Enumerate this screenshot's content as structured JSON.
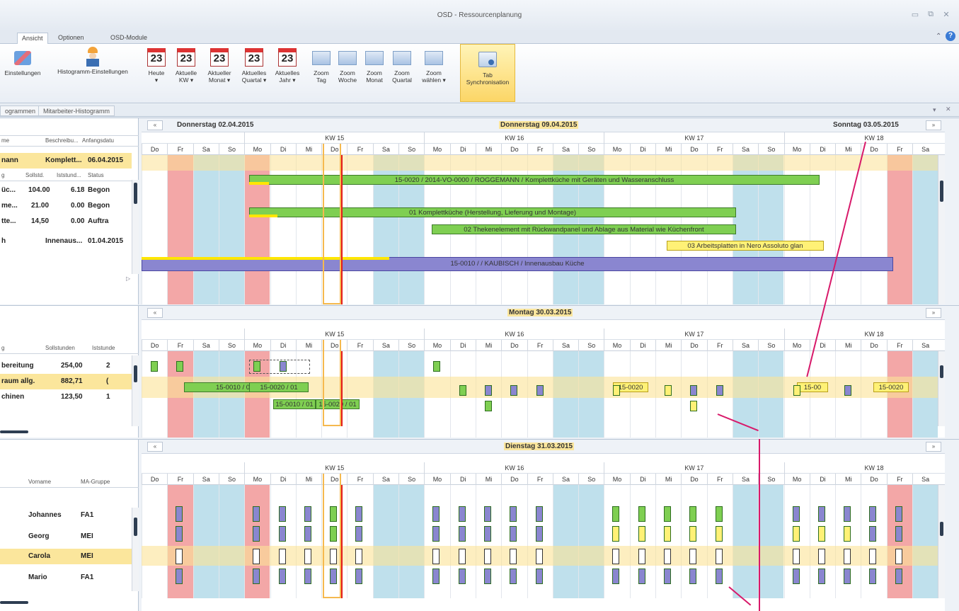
{
  "window": {
    "title": "OSD - Ressourcenplanung"
  },
  "menu_tabs": [
    "Ansicht",
    "Optionen",
    "OSD-Module"
  ],
  "ribbon": {
    "buttons": [
      {
        "label": "Einstellungen",
        "icon": "settings-icon"
      },
      {
        "label": "Histogramm-Einstellungen",
        "icon": "worker-icon"
      },
      {
        "label": "Heute",
        "sub": "▾",
        "icon": "calendar-icon",
        "num": "23"
      },
      {
        "label": "Aktuelle",
        "sub": "KW ▾",
        "icon": "calendar-icon",
        "num": "23"
      },
      {
        "label": "Aktueller",
        "sub": "Monat ▾",
        "icon": "calendar-icon",
        "num": "23"
      },
      {
        "label": "Aktuelles",
        "sub": "Quartal ▾",
        "icon": "calendar-icon",
        "num": "23"
      },
      {
        "label": "Aktuelles",
        "sub": "Jahr ▾",
        "icon": "calendar-icon",
        "num": "23"
      },
      {
        "label": "Zoom",
        "sub": "Tag",
        "icon": "zoom-day-icon"
      },
      {
        "label": "Zoom",
        "sub": "Woche",
        "icon": "zoom-week-icon"
      },
      {
        "label": "Zoom",
        "sub": "Monat",
        "icon": "zoom-month-icon"
      },
      {
        "label": "Zoom",
        "sub": "Quartal",
        "icon": "zoom-quarter-icon"
      },
      {
        "label": "Zoom",
        "sub": "wählen ▾",
        "icon": "zoom-select-icon"
      }
    ],
    "sync": {
      "label": "Tab",
      "sub": "Synchronisation"
    }
  },
  "subtabs": [
    "ogrammen",
    "Mitarbeiter-Histogramm"
  ],
  "days": [
    "Do",
    "Fr",
    "Sa",
    "So",
    "Mo",
    "Di",
    "Mi",
    "Do",
    "Fr",
    "Sa",
    "So",
    "Mo",
    "Di",
    "Mi",
    "Do",
    "Fr",
    "Sa",
    "So",
    "Mo",
    "Di",
    "Mi",
    "Do",
    "Fr",
    "Sa",
    "So",
    "Mo",
    "Di",
    "Mi",
    "Do",
    "Fr",
    "Sa"
  ],
  "weeks": [
    "KW 15",
    "KW 16",
    "KW 17",
    "KW 18"
  ],
  "panel1": {
    "nav_left": "Donnerstag 02.04.2015",
    "nav_center": "Donnerstag 09.04.2015",
    "nav_right": "Sonntag 03.05.2015",
    "headers": [
      "me",
      "Beschreibu...",
      "Anfangsdatu"
    ],
    "rows": [
      {
        "a": "nann",
        "b": "Komplett...",
        "c": "06.04.2015"
      }
    ],
    "subheaders": [
      "g",
      "Sollstd.",
      "Iststund...",
      "Status"
    ],
    "subrows": [
      {
        "a": "üc...",
        "b": "104.00",
        "c": "6.18",
        "d": "Begon"
      },
      {
        "a": "me...",
        "b": "21.00",
        "c": "0.00",
        "d": "Begon"
      },
      {
        "a": "tte...",
        "b": "14,50",
        "c": "0.00",
        "d": "Auftra"
      }
    ],
    "row2": {
      "a": "h",
      "b": "Innenaus...",
      "c": "01.04.2015"
    },
    "bars": [
      "15-0020 / 2014-VO-0000 / ROGGEMANN / Komplettküche mit Geräten und Wasseranschluss",
      "01 Komplettküche (Herstellung, Lieferung und Montage)",
      "02 Thekenelement mit Rückwandpanel und Ablage aus Material wie Küchenfront",
      "03 Arbeitsplatten in Nero Assoluto glan",
      "15-0010 / / KAUBISCH / Innenausbau Küche"
    ]
  },
  "panel2": {
    "nav_center": "Montag 30.03.2015",
    "headers": [
      "g",
      "Sollstunden",
      "Iststunde"
    ],
    "rows": [
      {
        "a": "bereitung",
        "b": "254,00",
        "c": "2"
      },
      {
        "a": "raum allg.",
        "b": "882,71",
        "c": "("
      },
      {
        "a": "chinen",
        "b": "123,50",
        "c": "1"
      }
    ],
    "bars": [
      "15-0010 / 01 / / KAU",
      "15-0020 / 01",
      "15-0010 / 01",
      "15-0020 / 01",
      "15-0020",
      "15-00",
      "15-0020"
    ]
  },
  "panel3": {
    "nav_center": "Dienstag 31.03.2015",
    "headers": [
      "Vorname",
      "MA-Gruppe"
    ],
    "rows": [
      {
        "a": "Johannes",
        "b": "FA1"
      },
      {
        "a": "Georg",
        "b": "MEI"
      },
      {
        "a": "Carola",
        "b": "MEI"
      },
      {
        "a": "Mario",
        "b": "FA1"
      }
    ]
  }
}
